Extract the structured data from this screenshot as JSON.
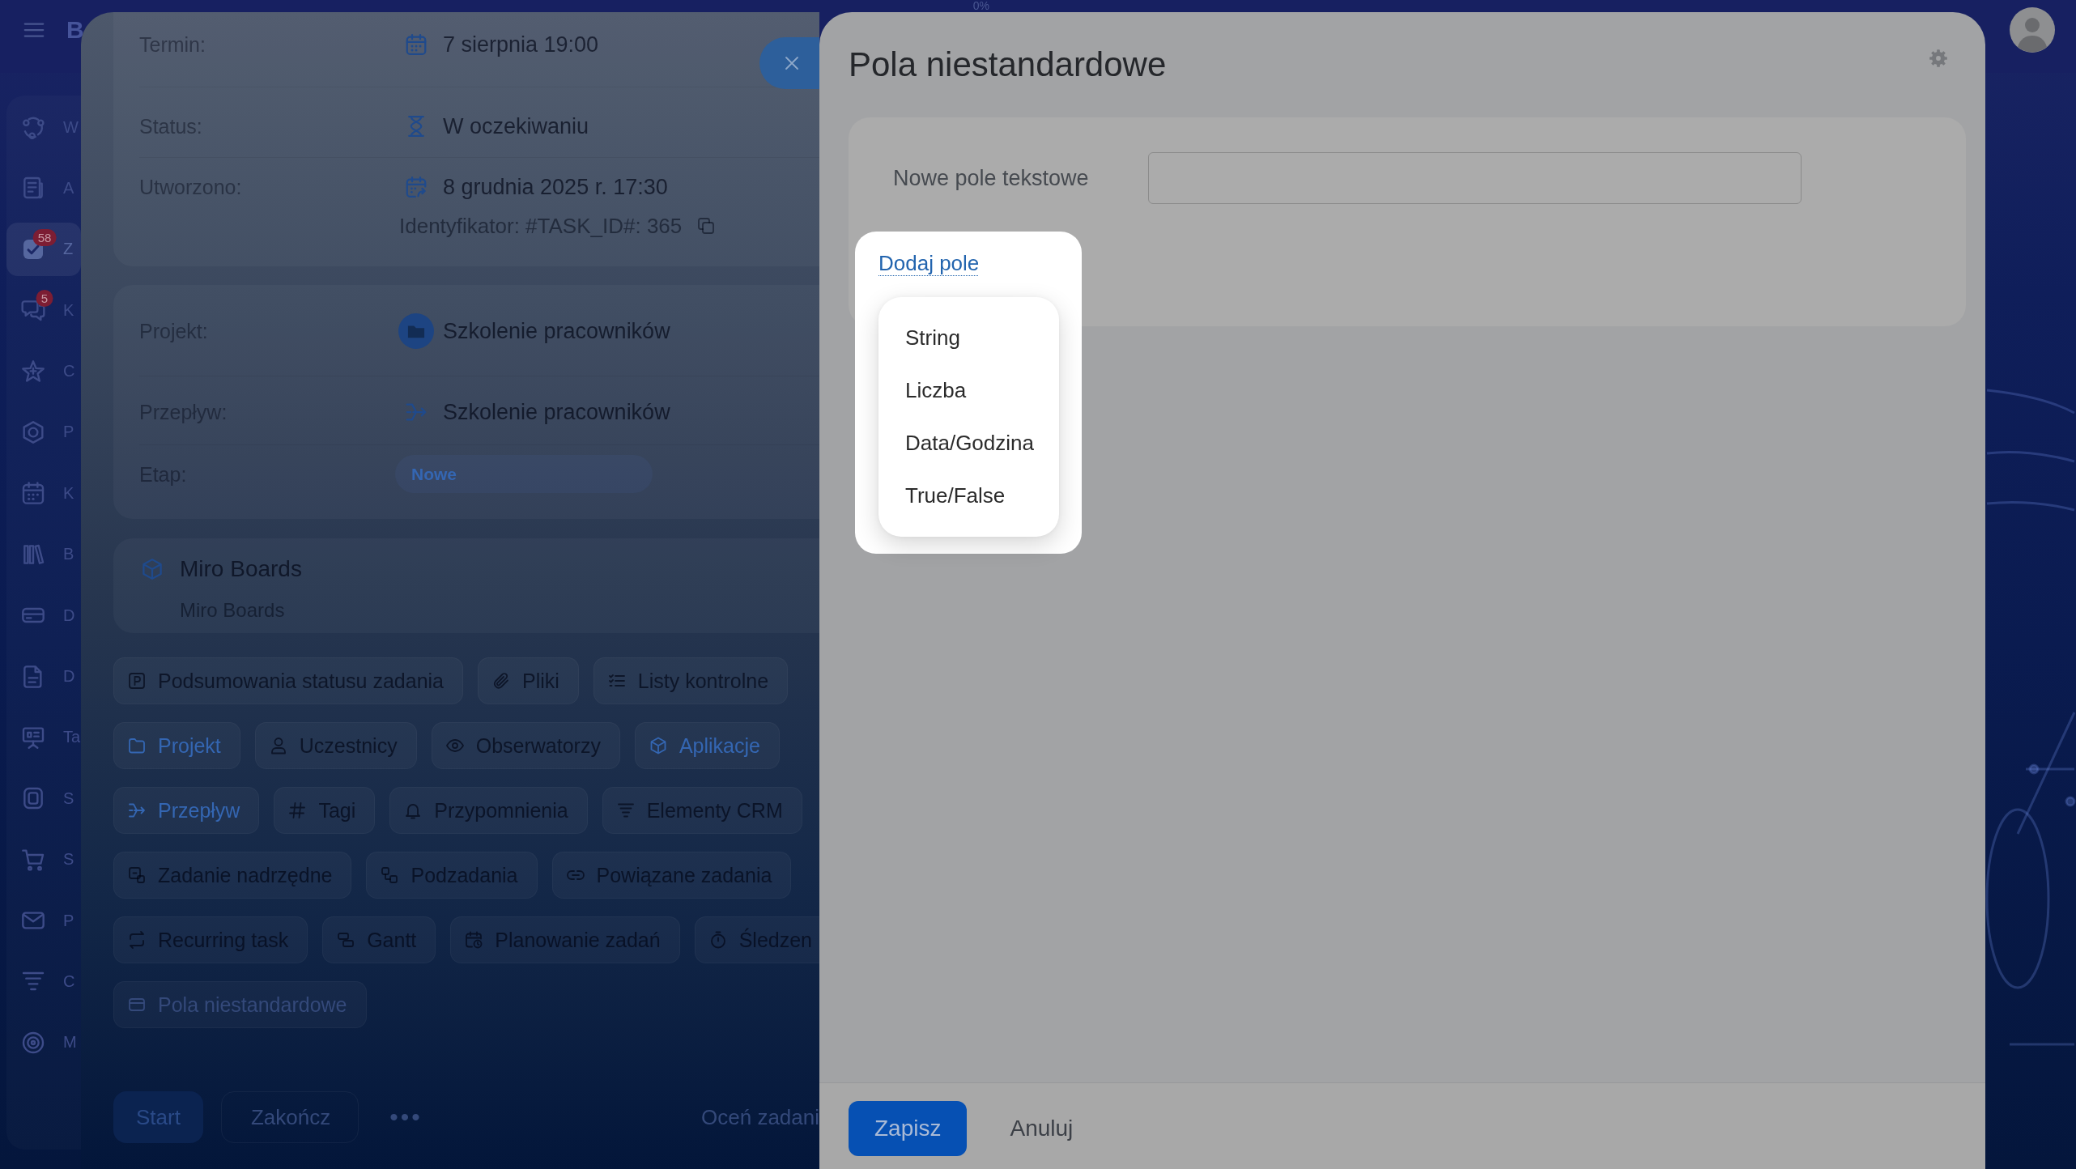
{
  "top_bar": {
    "logo": "B",
    "progress": "0%"
  },
  "sidebar": {
    "items": [
      {
        "label": "W",
        "selected": false
      },
      {
        "label": "A",
        "selected": false
      },
      {
        "label": "Z",
        "selected": true,
        "badge": "58"
      },
      {
        "label": "K",
        "selected": false,
        "badge": "5"
      },
      {
        "label": "C",
        "selected": false
      },
      {
        "label": "P",
        "selected": false
      },
      {
        "label": "K",
        "selected": false
      },
      {
        "label": "B",
        "selected": false
      },
      {
        "label": "D",
        "selected": false
      },
      {
        "label": "D",
        "selected": false
      },
      {
        "label": "Ta",
        "selected": false
      },
      {
        "label": "S",
        "selected": false
      },
      {
        "label": "S",
        "selected": false
      },
      {
        "label": "P",
        "selected": false
      },
      {
        "label": "C",
        "selected": false
      },
      {
        "label": "M",
        "selected": false
      }
    ]
  },
  "task_panel": {
    "details": [
      {
        "label": "Termin:",
        "value": "7 sierpnia 19:00"
      },
      {
        "label": "Status:",
        "value": "W oczekiwaniu"
      },
      {
        "label": "Utworzono:",
        "value": "8 grudnia 2025 r. 17:30",
        "note": "Identyfikator: #TASK_ID#: 365"
      }
    ],
    "links": [
      {
        "label": "Projekt:",
        "kind": "link",
        "value": "Szkolenie pracowników"
      },
      {
        "label": "Przepływ:",
        "kind": "link",
        "value": "Szkolenie pracowników"
      },
      {
        "label": "Etap:",
        "kind": "stage",
        "value": "Nowe"
      }
    ],
    "app": {
      "title": "Miro Boards",
      "subtitle": "Miro Boards"
    },
    "chip_rows": [
      [
        {
          "label": "Podsumowania statusu zadania",
          "active": false
        },
        {
          "label": "Pliki",
          "active": false
        },
        {
          "label": "Listy kontrolne",
          "active": false
        }
      ],
      [
        {
          "label": "Projekt",
          "active": true
        },
        {
          "label": "Uczestnicy",
          "active": false
        },
        {
          "label": "Obserwatorzy",
          "active": false
        },
        {
          "label": "Aplikacje",
          "active": true
        }
      ],
      [
        {
          "label": "Przepływ",
          "active": true
        },
        {
          "label": "Tagi",
          "active": false
        },
        {
          "label": "Przypomnienia",
          "active": false
        },
        {
          "label": "Elementy CRM",
          "active": false
        }
      ],
      [
        {
          "label": "Zadanie nadrzędne",
          "active": false
        },
        {
          "label": "Podzadania",
          "active": false
        },
        {
          "label": "Powiązane zadania",
          "active": false
        }
      ],
      [
        {
          "label": "Recurring task",
          "active": false
        },
        {
          "label": "Gantt",
          "active": false
        },
        {
          "label": "Planowanie zadań",
          "active": false
        },
        {
          "label": "Śledzen",
          "active": false
        }
      ],
      [
        {
          "label": "Pola niestandardowe",
          "active": false
        }
      ]
    ],
    "actions": [
      {
        "label": "Start",
        "kind": "primary"
      },
      {
        "label": "Zakończ",
        "kind": "secondary"
      },
      {
        "label": "•••",
        "kind": "more"
      }
    ],
    "rate_link": "Oceń zadani"
  },
  "dialog": {
    "title": "Pola niestandardowe",
    "fields": [
      {
        "label": "Nowe pole tekstowe"
      }
    ],
    "add_link": "Dodaj pole",
    "type_menu": [
      {
        "label": "String"
      },
      {
        "label": "Liczba"
      },
      {
        "label": "Data/Godzina"
      },
      {
        "label": "True/False"
      }
    ],
    "buttons": [
      {
        "label": "Zapisz",
        "kind": "primary"
      },
      {
        "label": "Anuluj",
        "kind": "link"
      }
    ]
  }
}
